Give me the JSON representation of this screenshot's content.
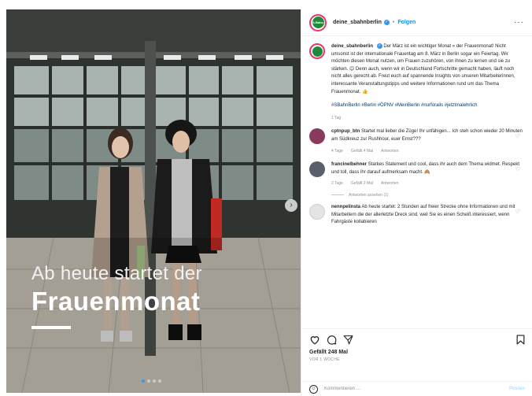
{
  "post": {
    "username": "deine_sbahnberlin",
    "separator": "•",
    "follow_label": "Folgen",
    "more_label": "···",
    "avatar_text": "S-Bahn"
  },
  "media": {
    "overlay_line1": "Ab heute startet der",
    "overlay_line2": "Frauenmonat",
    "next_arrow": "›",
    "slide_count": 4,
    "active_slide": 1
  },
  "caption": {
    "username": "deine_sbahnberlin",
    "text": "Der März ist ein wichtiger Monat » der Frauenmonat! Nicht umsonst ist der internationale Frauentag am 8. März in Berlin sogar ein Feiertag. Wir möchten diesen Monat nutzen, um Frauen zuzuhören, von ihnen zu lernen und sie zu stärken. 😊 Denn auch, wenn wir in Deutschland Fortschritte gemacht haben, läuft noch nicht alles gerecht ab. Freut euch auf spannende Insights von unseren Mitarbeiterinnen, interessante Veranstaltungstipps und weitere Informationen rund um das Thema Frauenmonat. 👍",
    "hashtags": "#SBahnBerlin #Berlin #ÖPNV #MeinBerlin #nurforails #jetztmalehrlich",
    "ago": "1 Tag"
  },
  "comments": [
    {
      "username": "cptnpup_btn",
      "text": "Startet mal lieber die Züge! Ihr unfähigen... Ich steh schon wieder 20 Minuten am Südkreuz zur Rushhour, euer Ernst???",
      "ago": "4 Tage",
      "likes": "Gefällt 4 Mal",
      "reply": "Antworten",
      "avatar_color": "#8a3a5c"
    },
    {
      "username": "francinelbehner",
      "text": "Starkes Statement und cool, dass ihr auch dem Thema widmet. Respekt und toll, dass ihr darauf aufmerksam macht. 🙈",
      "ago": "2 Tage",
      "likes": "Gefällt 2 Mal",
      "reply": "Antworten",
      "avatar_color": "#5a5f6b",
      "view_replies": "Antworten ansehen (1)"
    },
    {
      "username": "nennpelinsta",
      "text": "Ab heute startet: 2 Stunden auf freier Strecke ohne Informationen und mit Mitarbeitern die der allerletzte Dreck sind, weil Sie es einen Scheiß interessiert, wenn Fahrgäste kollabieren",
      "avatar_color": "#d9d9d9"
    }
  ],
  "footer": {
    "likes": "Gefällt 248 Mal",
    "date": "VOR 1 WOCHE",
    "comment_placeholder": "Kommentieren ...",
    "post_label": "Posten"
  },
  "colors": {
    "brand_green": "#1f8b3a",
    "link_blue": "#0095f6",
    "verified_blue": "#3897f0",
    "hashtag": "#00376b"
  }
}
